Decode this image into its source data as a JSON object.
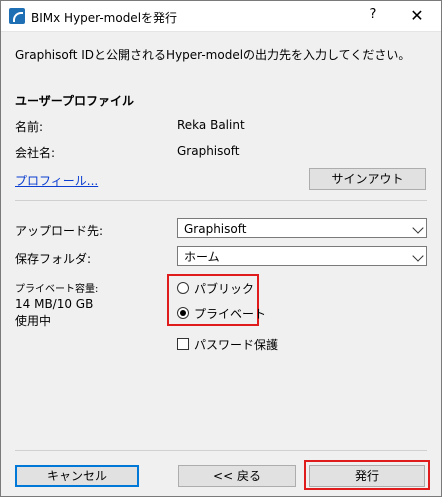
{
  "window": {
    "title": "BIMx Hyper-modelを発行",
    "help": "?",
    "close": "✕"
  },
  "intro": "Graphisoft IDと公開されるHyper-modelの出力先を入力してください。",
  "profile": {
    "heading": "ユーザープロファイル",
    "name_label": "名前:",
    "name_value": "Reka Balint",
    "company_label": "会社名:",
    "company_value": "Graphisoft",
    "profile_link": "プロフィール...",
    "signout_label": "サインアウト"
  },
  "upload": {
    "label": "アップロード先:",
    "value": "Graphisoft"
  },
  "folder": {
    "label": "保存フォルダ:",
    "value": "ホーム"
  },
  "storage": {
    "label": "プライベート容量:",
    "amount": "14 MB/10 GB",
    "status": "使用中"
  },
  "visibility": {
    "public_label": "パブリック",
    "private_label": "プライベート",
    "selected": "private"
  },
  "password_label": "パスワード保護",
  "buttons": {
    "cancel": "キャンセル",
    "back": "<< 戻る",
    "publish": "発行"
  }
}
